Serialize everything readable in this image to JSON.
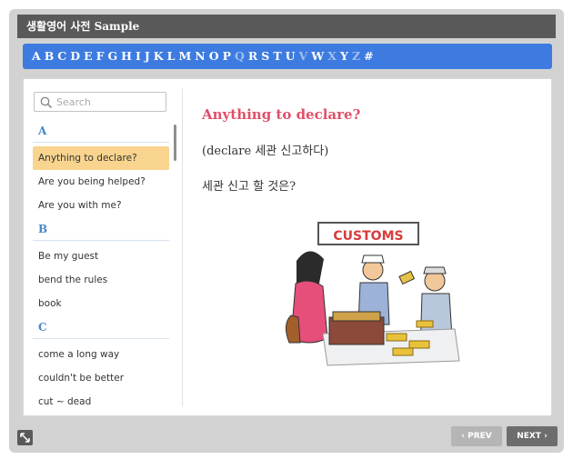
{
  "window": {
    "title": "생활영어 사전 Sample"
  },
  "alphabet": [
    {
      "letter": "A",
      "enabled": true
    },
    {
      "letter": "B",
      "enabled": true
    },
    {
      "letter": "C",
      "enabled": true
    },
    {
      "letter": "D",
      "enabled": true
    },
    {
      "letter": "E",
      "enabled": true
    },
    {
      "letter": "F",
      "enabled": true
    },
    {
      "letter": "G",
      "enabled": true
    },
    {
      "letter": "H",
      "enabled": true
    },
    {
      "letter": "I",
      "enabled": true
    },
    {
      "letter": "J",
      "enabled": true
    },
    {
      "letter": "K",
      "enabled": true
    },
    {
      "letter": "L",
      "enabled": true
    },
    {
      "letter": "M",
      "enabled": true
    },
    {
      "letter": "N",
      "enabled": true
    },
    {
      "letter": "O",
      "enabled": true
    },
    {
      "letter": "P",
      "enabled": true
    },
    {
      "letter": "Q",
      "enabled": false
    },
    {
      "letter": "R",
      "enabled": true
    },
    {
      "letter": "S",
      "enabled": true
    },
    {
      "letter": "T",
      "enabled": true
    },
    {
      "letter": "U",
      "enabled": true
    },
    {
      "letter": "V",
      "enabled": false
    },
    {
      "letter": "W",
      "enabled": true
    },
    {
      "letter": "X",
      "enabled": false
    },
    {
      "letter": "Y",
      "enabled": true
    },
    {
      "letter": "Z",
      "enabled": false
    },
    {
      "letter": "#",
      "enabled": true
    }
  ],
  "search": {
    "placeholder": "Search",
    "value": ""
  },
  "list": [
    {
      "letter": "A",
      "items": [
        "Anything to declare?",
        "Are you being helped?",
        "Are you with me?"
      ]
    },
    {
      "letter": "B",
      "items": [
        "Be my guest",
        "bend the rules",
        "book"
      ]
    },
    {
      "letter": "C",
      "items": [
        "come a long way",
        "couldn't be better",
        "cut ~ dead"
      ]
    }
  ],
  "selected_item": "Anything to declare?",
  "entry": {
    "phrase": "Anything to declare?",
    "pronunciation": "(declare 세관 신고하다)",
    "meaning": "세관 신고 할 것은?",
    "illustration_sign": "CUSTOMS"
  },
  "nav": {
    "prev_label": "PREV",
    "next_label": "NEXT"
  },
  "colors": {
    "accent": "#3d7be0",
    "heading": "#e14f68",
    "selected": "#f9d48e",
    "titlebar": "#595959"
  }
}
